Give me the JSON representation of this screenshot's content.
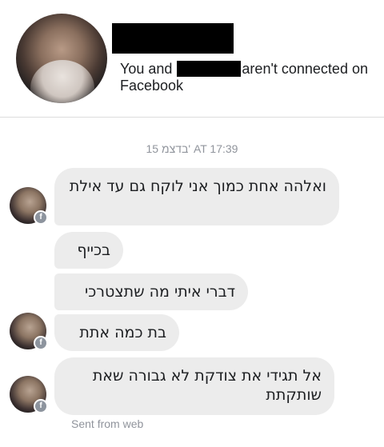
{
  "header": {
    "connection_prefix": "You and ",
    "connection_suffix": "aren't connected on Facebook"
  },
  "conversation": {
    "timestamp": "15 בדצמ' AT 17:39",
    "messages": [
      {
        "text": "ואלהה אחת כמוך אני לוקח גם עד אילת"
      },
      {
        "text": "בכייף"
      },
      {
        "text": "דברי איתי מה שתצטרכי"
      },
      {
        "text": "בת כמה אתת"
      },
      {
        "text": "אל תגידי את צודקת  לא גבורה שאת שותקתת"
      }
    ],
    "sent_from": "Sent from web"
  },
  "icons": {
    "badge": "facebook-badge-icon",
    "badge_glyph": "f"
  },
  "colors": {
    "bubble_bg": "#ececec",
    "meta_text": "#90949c",
    "redaction": "#000000"
  }
}
